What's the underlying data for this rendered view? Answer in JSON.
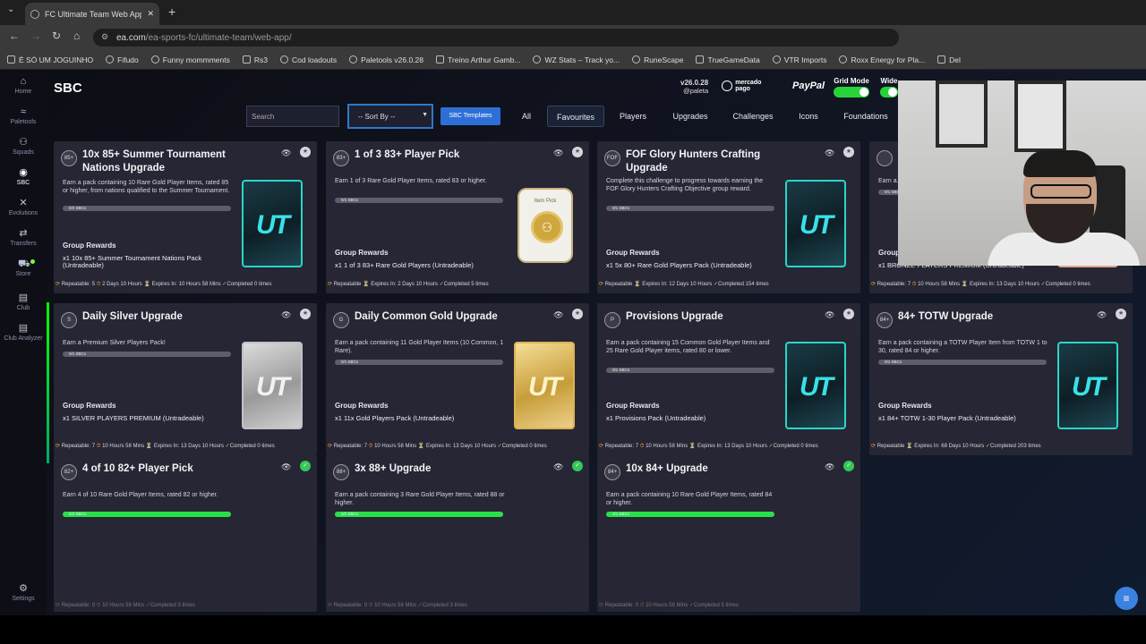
{
  "browser": {
    "tab_title": "FC Ultimate Team Web App - EA",
    "url_domain": "ea.com",
    "url_path": "/ea-sports-fc/ultimate-team/web-app/",
    "bookmarks": [
      "É SÓ UM JOGUINHO",
      "Fifudo",
      "Funny mommments",
      "Rs3",
      "Cod loadouts",
      "Paletools v26.0.28",
      "Treino Arthur Gamb...",
      "WZ Stats – Track yo...",
      "RuneScape",
      "TrueGameData",
      "VTR Imports",
      "Roxx Energy for Pla...",
      "Del"
    ]
  },
  "sidebar": {
    "items": [
      {
        "label": "Home",
        "icon": "home-icon"
      },
      {
        "label": "Paletools",
        "icon": "paletools-icon"
      },
      {
        "label": "Squads",
        "icon": "squads-icon"
      },
      {
        "label": "SBC",
        "icon": "sbc-icon"
      },
      {
        "label": "Evolutions",
        "icon": "evolutions-icon"
      },
      {
        "label": "Transfers",
        "icon": "transfers-icon"
      },
      {
        "label": "Store",
        "icon": "store-icon"
      },
      {
        "label": "Club",
        "icon": "club-icon"
      },
      {
        "label": "Club Analyzer",
        "icon": "club-analyzer-icon"
      },
      {
        "label": "Settings",
        "icon": "gear-icon"
      }
    ]
  },
  "header": {
    "title": "SBC",
    "version": "v26.0.28",
    "user": "@paleta",
    "mercado_pago": "mercado pago",
    "paypal": "PayPal",
    "grid_mode": "Grid Mode",
    "wide": "Wide"
  },
  "filters": {
    "search_placeholder": "Search",
    "sort_label": "-- Sort By --",
    "templates_label": "SBC Templates",
    "tabs": [
      "All",
      "Favourites",
      "Players",
      "Upgrades",
      "Challenges",
      "Icons",
      "Foundations"
    ]
  },
  "cards": [
    {
      "title": "10x 85+ Summer Tournament Nations Upgrade",
      "badge": "85+",
      "desc": "Earn a pack containing 10 Rare Gold Player Items, rated 85 or higher, from nations qualified to the Summer Tournament.",
      "progress": "0/2 SBCs",
      "progress_fraction": 0,
      "group_rewards": "Group Rewards",
      "reward": "x1 10x 85+ Summer Tournament Nations Pack (Untradeable)",
      "footer_repeat": "Repeatable: 5",
      "footer_time": "2 Days 10 Hours",
      "footer_expires": "Expires In: 10 Hours 58 Mins",
      "footer_completed": "Completed 0 times",
      "art": "pack-teal",
      "done": false
    },
    {
      "title": "1 of 3 83+ Player Pick",
      "badge": "83+",
      "desc": "Earn 1 of 3 Rare Gold Player Items, rated 83 or higher.",
      "progress": "0/1 SBCs",
      "progress_fraction": 0,
      "group_rewards": "Group Rewards",
      "reward": "x1 1 of 3 83+ Rare Gold Players (Untradeable)",
      "footer_repeat": "Repeatable",
      "footer_time": "",
      "footer_expires": "Expires In: 2 Days 10 Hours",
      "footer_completed": "Completed 5 times",
      "art": "item-pick",
      "pick_label": "Item Pick",
      "done": false
    },
    {
      "title": "FOF Glory Hunters Crafting Upgrade",
      "badge": "FOF",
      "desc": "Complete this challenge to progress towards earning the FOF Glory Hunters Crafting Objective group reward.",
      "progress": "0/1 SBCs",
      "progress_fraction": 0,
      "group_rewards": "Group Rewards",
      "reward": "x1 5x 80+ Rare Gold Players Pack (Untradeable)",
      "footer_repeat": "Repeatable",
      "footer_time": "",
      "footer_expires": "Expires In: 12 Days 10 Hours",
      "footer_completed": "Completed 154 times",
      "art": "pack-teal",
      "done": false
    },
    {
      "title": "",
      "badge": "",
      "desc": "Earn a...",
      "progress": "0/1 SBCs",
      "progress_fraction": 0,
      "group_rewards": "Group Rewards",
      "reward": "x1 BRONZE PLAYERS PREMIUM (Untradeable)",
      "footer_repeat": "Repeatable: 7",
      "footer_time": "10 Hours 58 Mins",
      "footer_expires": "Expires In: 13 Days 10 Hours",
      "footer_completed": "Completed 0 times",
      "art": "pack-bronze",
      "done": false
    },
    {
      "title": "Daily Silver Upgrade",
      "badge": "S",
      "desc": "Earn a Premium Silver Players Pack!",
      "progress": "0/1 SBCs",
      "progress_fraction": 0,
      "group_rewards": "Group Rewards",
      "reward": "x1 SILVER PLAYERS PREMIUM (Untradeable)",
      "footer_repeat": "Repeatable: 7",
      "footer_time": "10 Hours 58 Mins",
      "footer_expires": "Expires In: 13 Days 10 Hours",
      "footer_completed": "Completed 0 times",
      "art": "pack-silver",
      "done": false
    },
    {
      "title": "Daily Common Gold Upgrade",
      "badge": "G",
      "desc": "Earn a pack containing 11 Gold Player Items (10 Common, 1 Rare).",
      "progress": "0/1 SBCs",
      "progress_fraction": 0,
      "group_rewards": "Group Rewards",
      "reward": "x1 11x Gold Players Pack (Untradeable)",
      "footer_repeat": "Repeatable: 7",
      "footer_time": "10 Hours 58 Mins",
      "footer_expires": "Expires In: 13 Days 10 Hours",
      "footer_completed": "Completed 0 times",
      "art": "pack-gold",
      "done": false
    },
    {
      "title": "Provisions Upgrade",
      "badge": "P",
      "desc": "Earn a pack containing 15 Common Gold Player Items and 25 Rare Gold Player items, rated 80 or lower.",
      "progress": "0/1 SBCs",
      "progress_fraction": 0,
      "group_rewards": "Group Rewards",
      "reward": "x1 Provisions Pack (Untradeable)",
      "footer_repeat": "Repeatable: 7",
      "footer_time": "10 Hours 58 Mins",
      "footer_expires": "Expires In: 13 Days 10 Hours",
      "footer_completed": "Completed 0 times",
      "art": "pack-teal",
      "done": false
    },
    {
      "title": "84+ TOTW Upgrade",
      "badge": "84+",
      "desc": "Earn a pack containing a TOTW Player Item from TOTW 1 to 30, rated 84 or higher.",
      "progress": "0/1 SBCs",
      "progress_fraction": 0,
      "group_rewards": "Group Rewards",
      "reward": "x1 84+ TOTW 1-30 Player Pack (Untradeable)",
      "footer_repeat": "Repeatable",
      "footer_time": "",
      "footer_expires": "Expires In: 68 Days 10 Hours",
      "footer_completed": "Completed 203 times",
      "art": "pack-teal",
      "done": false
    },
    {
      "title": "4 of 10 82+ Player Pick",
      "badge": "82+",
      "desc": "Earn 4 of 10 Rare Gold Player Items, rated 82 or higher.",
      "progress": "2/2 SBCs",
      "progress_fraction": 1,
      "group_rewards": "",
      "reward": "",
      "footer_repeat": "Repeatable: 0",
      "footer_time": "10 Hours 58 Mins",
      "footer_expires": "",
      "footer_completed": "Completed 3 times",
      "art": "none",
      "done": true
    },
    {
      "title": "3x 88+ Upgrade",
      "badge": "88+",
      "desc": "Earn a pack containing 3 Rare Gold Player Items, rated 88 or higher.",
      "progress": "2/2 SBCs",
      "progress_fraction": 1,
      "group_rewards": "",
      "reward": "",
      "footer_repeat": "Repeatable: 0",
      "footer_time": "10 Hours 58 Mins",
      "footer_expires": "",
      "footer_completed": "Completed 3 times",
      "art": "none",
      "done": true
    },
    {
      "title": "10x 84+ Upgrade",
      "badge": "84+",
      "desc": "Earn a pack containing 10 Rare Gold Player Items, rated 84 or higher.",
      "progress": "1/1 SBCs",
      "progress_fraction": 1,
      "group_rewards": "",
      "reward": "",
      "footer_repeat": "Repeatable: 0",
      "footer_time": "10 Hours 58 Mins",
      "footer_expires": "",
      "footer_completed": "Completed 5 times",
      "art": "none",
      "done": true
    }
  ],
  "colors": {
    "accent_blue": "#2d79c7",
    "progress_green": "#27e04a",
    "card_bg": "#262634"
  }
}
